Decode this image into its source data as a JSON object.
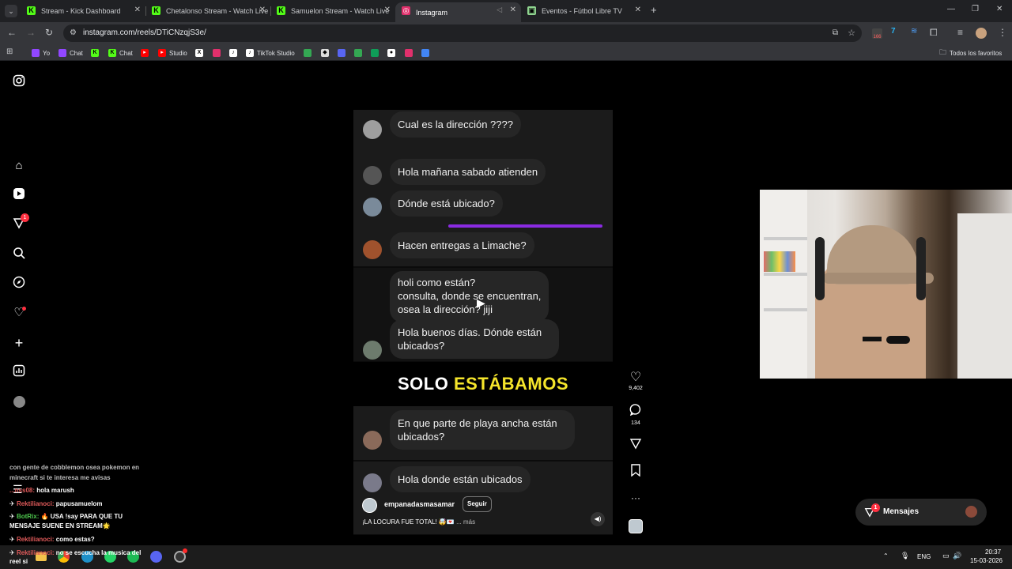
{
  "tabs": [
    {
      "title": "Stream - Kick Dashboard",
      "favicon": "K",
      "color": "#53fc18"
    },
    {
      "title": "Chetalonso Stream - Watch Live",
      "favicon": "K",
      "color": "#53fc18"
    },
    {
      "title": "Samuelon Stream - Watch Live",
      "favicon": "K",
      "color": "#53fc18"
    },
    {
      "title": "Instagram",
      "favicon": "◎",
      "color": "#e1306c"
    },
    {
      "title": "Eventos - Fútbol Libre TV",
      "favicon": "▣",
      "color": "#8fd48f"
    }
  ],
  "address": "instagram.com/reels/DTiCNzqjS3e/",
  "extensions": {
    "badge": "166"
  },
  "bookmarks": [
    {
      "label": "Yo",
      "color": "#9147ff"
    },
    {
      "label": "Chat",
      "color": "#9147ff"
    },
    {
      "label": "",
      "color": "#53fc18"
    },
    {
      "label": "Chat",
      "color": "#53fc18"
    },
    {
      "label": "",
      "color": "#ff0000"
    },
    {
      "label": "Studio",
      "color": "#ff0000"
    },
    {
      "label": "",
      "color": "#ffffff"
    },
    {
      "label": "",
      "color": "#e1306c"
    },
    {
      "label": "",
      "color": "#ffffff"
    },
    {
      "label": "TikTok Studio",
      "color": "#ffffff"
    },
    {
      "label": "",
      "color": "#34a853"
    },
    {
      "label": "",
      "color": "#ffffff"
    },
    {
      "label": "",
      "color": "#5865f2"
    },
    {
      "label": "",
      "color": "#34a853"
    },
    {
      "label": "",
      "color": "#0f9d58"
    },
    {
      "label": "",
      "color": "#ffffff"
    },
    {
      "label": "",
      "color": "#e1306c"
    },
    {
      "label": "",
      "color": "#4285f4"
    }
  ],
  "all_bookmarks": "Todos los favoritos",
  "nav": {
    "notifications_badge": "1"
  },
  "reel": {
    "comments": [
      "Cual es la dirección ????",
      "Hola mañana sabado atienden",
      "Dónde está ubicado?",
      "Hacen entregas a Limache?",
      "holi como están?\nconsulta, donde se encuentran,\nosea la dirección? jiji",
      "Hola buenos días. Dónde están ubicados?",
      "En que parte de playa ancha están ubicados?",
      "Hola donde están ubicados"
    ],
    "banner_white": "SOLO",
    "banner_yellow": "ESTÁBAMOS",
    "account": "empanadasmasamar",
    "follow": "Seguir",
    "caption": "¡LA LOCURA FUE TOTAL! 🤯💌",
    "more": "... más",
    "likes": "9,402",
    "comment_count": "134"
  },
  "messages": {
    "label": "Mensajes",
    "badge": "1"
  },
  "chat": [
    {
      "user": "",
      "text": "con gente de cobblemon osea pokemon en"
    },
    {
      "user": "",
      "text": "minecraft si te interesa me avisas"
    },
    {
      "user": "...nss08:",
      "text": "hola marush"
    },
    {
      "user": "Rektilianoci:",
      "text": "papusamuelom"
    },
    {
      "user": "BotRix:",
      "text": "🔥 USA !say PARA QUE TU"
    },
    {
      "user": "",
      "text": "MENSAJE SUENE EN STREAM🌟"
    },
    {
      "user": "Rektilianoci:",
      "text": "como estas?"
    },
    {
      "user": "Rektilianoci:",
      "text": "no se escucha la musica del"
    },
    {
      "user": "",
      "text": "reel si"
    }
  ],
  "taskbar": {
    "lang": "ENG",
    "time": "20:37",
    "date": "15-03-2026"
  }
}
